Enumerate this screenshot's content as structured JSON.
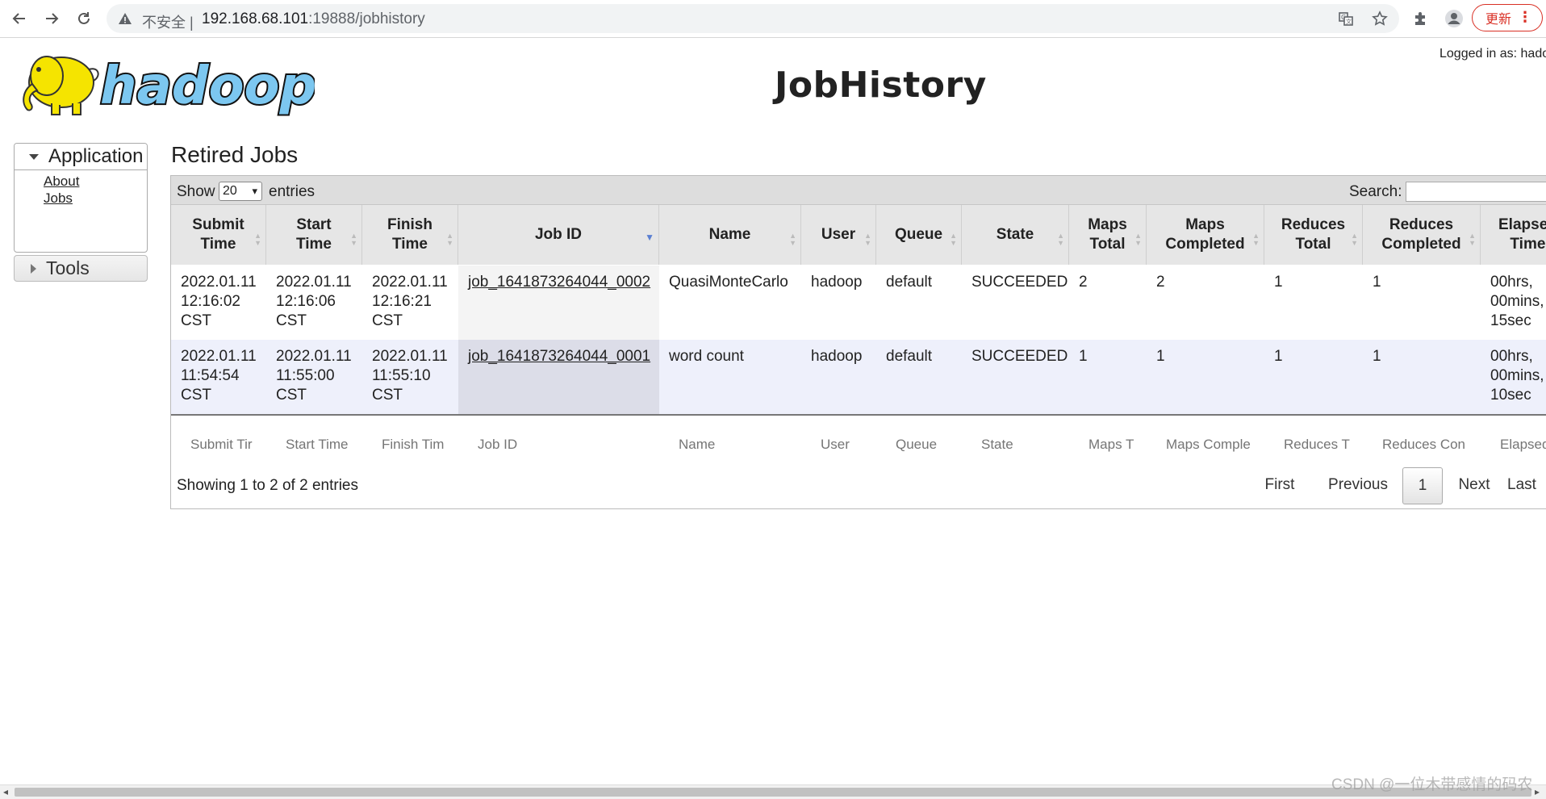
{
  "browser": {
    "insecure_label": "不安全 |",
    "url_host": "192.168.68.101",
    "url_rest": ":19888/jobhistory",
    "update_label": "更新"
  },
  "header": {
    "logo_text": "hadoop",
    "title": "JobHistory",
    "logged_in": "Logged in as: hadoop"
  },
  "sidebar": {
    "application_label": "Application",
    "links": [
      "About",
      "Jobs"
    ],
    "tools_label": "Tools"
  },
  "main": {
    "section_title": "Retired Jobs",
    "show_label": "Show",
    "page_length": "20",
    "entries_label": "entries",
    "search_label": "Search:",
    "search_value": "",
    "columns": [
      "Submit\nTime",
      "Start\nTime",
      "Finish\nTime",
      "Job ID",
      "Name",
      "User",
      "Queue",
      "State",
      "Maps\nTotal",
      "Maps\nCompleted",
      "Reduces\nTotal",
      "Reduces\nCompleted",
      "Elapsed\nTime"
    ],
    "rows": [
      [
        "2022.01.11\n12:16:02\nCST",
        "2022.01.11\n12:16:06\nCST",
        "2022.01.11\n12:16:21\nCST",
        "job_1641873264044_0002",
        "QuasiMonteCarlo",
        "hadoop",
        "default",
        "SUCCEEDED",
        "2",
        "2",
        "1",
        "1",
        "00hrs,\n00mins,\n15sec"
      ],
      [
        "2022.01.11\n11:54:54\nCST",
        "2022.01.11\n11:55:00\nCST",
        "2022.01.11\n11:55:10\nCST",
        "job_1641873264044_0001",
        "word count",
        "hadoop",
        "default",
        "SUCCEEDED",
        "1",
        "1",
        "1",
        "1",
        "00hrs,\n00mins,\n10sec"
      ]
    ],
    "filters": [
      "Submit Tir",
      "Start Time",
      "Finish Tim",
      "Job ID",
      "Name",
      "User",
      "Queue",
      "State",
      "Maps T",
      "Maps Comple",
      "Reduces T",
      "Reduces Con",
      "Elapsed"
    ],
    "info": "Showing 1 to 2 of 2 entries",
    "pagination": [
      "First",
      "Previous",
      "1",
      "Next",
      "Last"
    ]
  },
  "watermark": "CSDN @一位木带感情的码农",
  "colors": {
    "logo_yellow": "#f5e400",
    "logo_blue": "#7cc7f0",
    "table_header_bg": "#e6e6e6",
    "toolbar_bg": "#dddddd",
    "even_row_bg": "#eef0fb",
    "sort_arrow": "#5b7fd1",
    "update_red": "#d93025"
  },
  "icons": [
    "back-icon",
    "forward-icon",
    "reload-icon",
    "warning-icon",
    "translate-icon",
    "star-icon",
    "extensions-icon",
    "profile-icon",
    "menu-dots-icon"
  ]
}
